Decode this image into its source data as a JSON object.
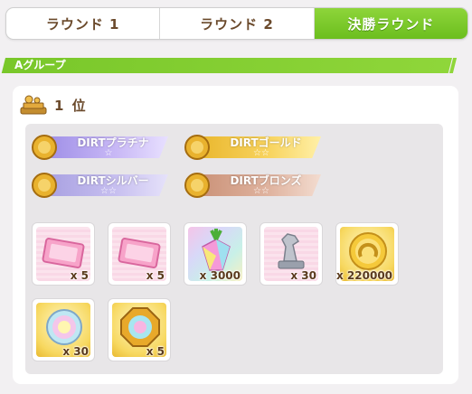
{
  "tabs": [
    {
      "label": "ラウンド 1",
      "active": false
    },
    {
      "label": "ラウンド 2",
      "active": false
    },
    {
      "label": "決勝ラウンド",
      "active": true
    }
  ],
  "group": {
    "label": "Aグループ"
  },
  "rank": {
    "label": "1 位",
    "icon": "trophy-icon"
  },
  "badges": [
    {
      "label": "DIRTプラチナ",
      "stars": "☆",
      "color": "#b7a6ee"
    },
    {
      "label": "DIRTゴールド",
      "stars": "☆☆",
      "color": "#f3c63a"
    },
    {
      "label": "DIRTシルバー",
      "stars": "☆☆",
      "color": "#b0a8e4"
    },
    {
      "label": "DIRTブロンズ",
      "stars": "☆☆",
      "color": "#d8a690"
    }
  ],
  "items": [
    {
      "icon": "pink-ticket-icon",
      "count": "x 5"
    },
    {
      "icon": "pink-ticket-icon",
      "count": "x 5"
    },
    {
      "icon": "rainbow-carrot-icon",
      "count": "x 3000"
    },
    {
      "icon": "silver-horse-statue-icon",
      "count": "x 30"
    },
    {
      "icon": "gold-horseshoe-coin-icon",
      "count": "x 220000"
    },
    {
      "icon": "rainbow-disc-icon",
      "count": "x 30"
    },
    {
      "icon": "gold-octagon-medal-icon",
      "count": "x 5"
    }
  ]
}
